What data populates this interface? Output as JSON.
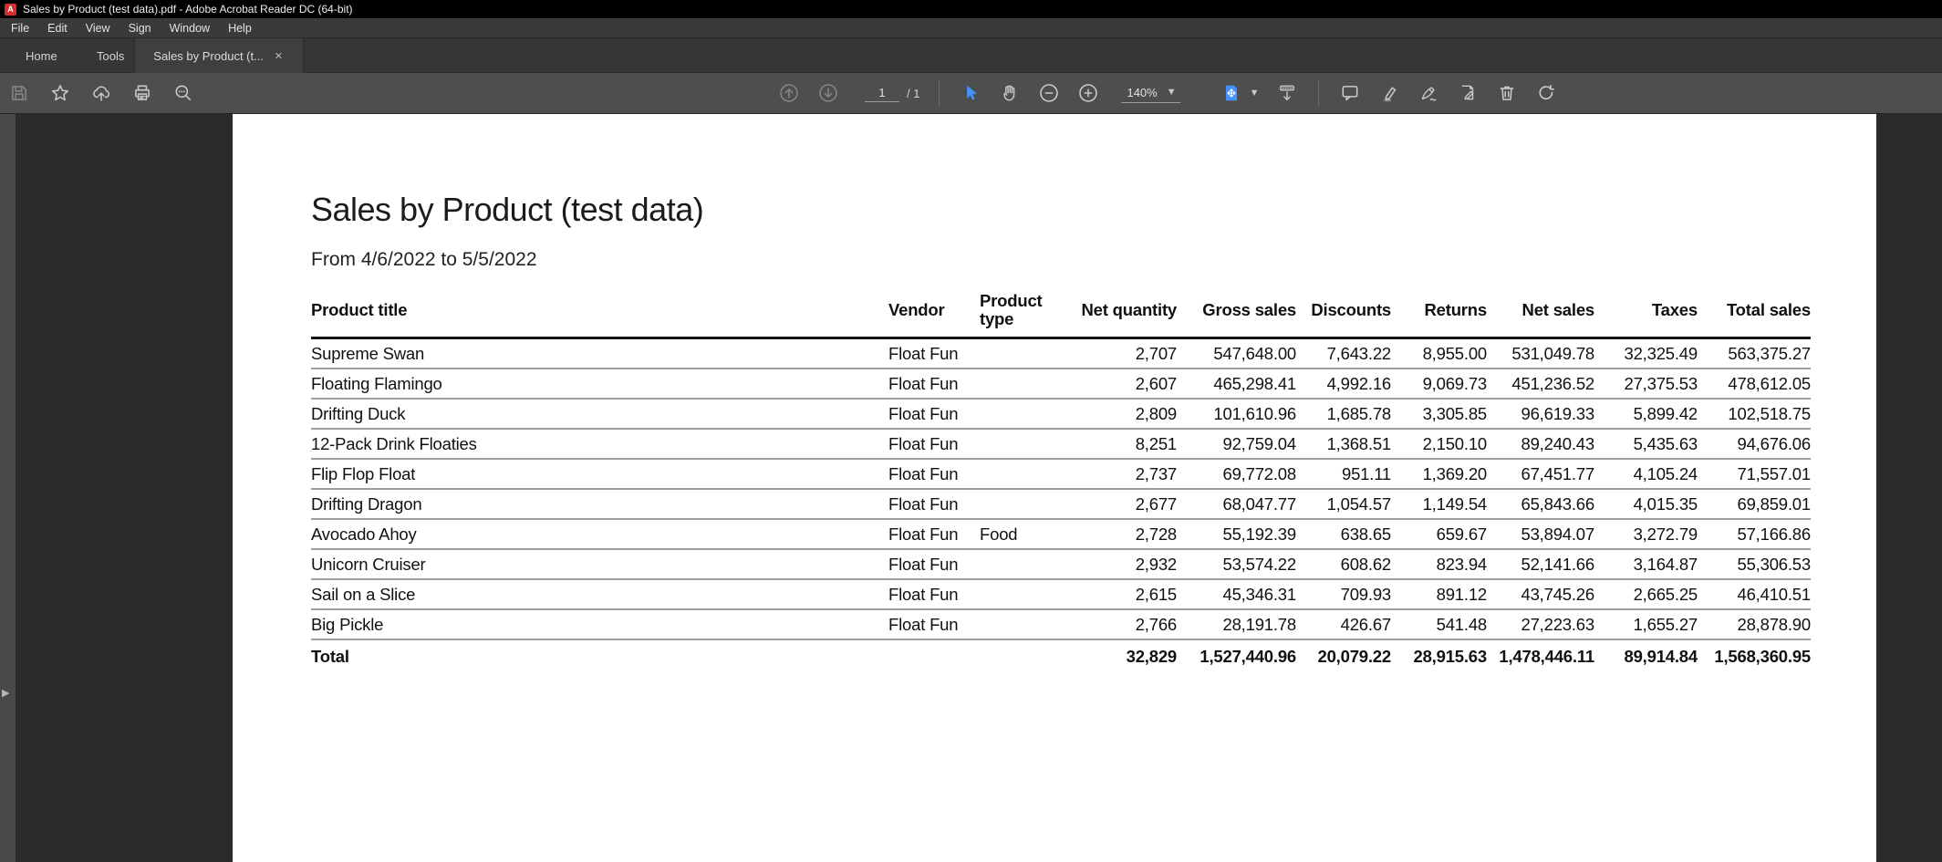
{
  "window": {
    "title": "Sales by Product (test data).pdf - Adobe Acrobat Reader DC (64-bit)",
    "app_icon": "adobe-acrobat-icon"
  },
  "menu": {
    "items": [
      "File",
      "Edit",
      "View",
      "Sign",
      "Window",
      "Help"
    ]
  },
  "tabs": {
    "home": "Home",
    "tools": "Tools",
    "document_tab": "Sales by Product (t...",
    "close": "×"
  },
  "toolbar": {
    "page_current": "1",
    "page_total": "/ 1",
    "zoom_level": "140%",
    "left_icons": [
      "save-icon",
      "star-favorites-icon",
      "cloud-upload-icon",
      "print-icon",
      "search-icon"
    ],
    "center_icons": [
      "page-up-icon",
      "page-down-icon",
      "select-tool-icon",
      "hand-tool-icon",
      "zoom-out-icon",
      "zoom-in-icon",
      "page-display-icon",
      "hide-toolbar-icon",
      "comment-icon",
      "highlight-icon",
      "fill-sign-icon",
      "edit-page-icon",
      "delete-icon",
      "refresh-icon"
    ],
    "accent_color": "#4593ff",
    "icon_color": "#c9c9c9"
  },
  "sidebar": {
    "expand_arrow": "▶"
  },
  "document": {
    "title": "Sales by Product (test data)",
    "subtitle": "From 4/6/2022 to 5/5/2022",
    "table": {
      "columns": [
        "Product title",
        "Vendor",
        "Product type",
        "Net quantity",
        "Gross sales",
        "Discounts",
        "Returns",
        "Net sales",
        "Taxes",
        "Total sales"
      ],
      "rows": [
        [
          "Supreme Swan",
          "Float Fun",
          "",
          "2,707",
          "547,648.00",
          "7,643.22",
          "8,955.00",
          "531,049.78",
          "32,325.49",
          "563,375.27"
        ],
        [
          "Floating Flamingo",
          "Float Fun",
          "",
          "2,607",
          "465,298.41",
          "4,992.16",
          "9,069.73",
          "451,236.52",
          "27,375.53",
          "478,612.05"
        ],
        [
          "Drifting Duck",
          "Float Fun",
          "",
          "2,809",
          "101,610.96",
          "1,685.78",
          "3,305.85",
          "96,619.33",
          "5,899.42",
          "102,518.75"
        ],
        [
          "12-Pack Drink Floaties",
          "Float Fun",
          "",
          "8,251",
          "92,759.04",
          "1,368.51",
          "2,150.10",
          "89,240.43",
          "5,435.63",
          "94,676.06"
        ],
        [
          "Flip Flop Float",
          "Float Fun",
          "",
          "2,737",
          "69,772.08",
          "951.11",
          "1,369.20",
          "67,451.77",
          "4,105.24",
          "71,557.01"
        ],
        [
          "Drifting Dragon",
          "Float Fun",
          "",
          "2,677",
          "68,047.77",
          "1,054.57",
          "1,149.54",
          "65,843.66",
          "4,015.35",
          "69,859.01"
        ],
        [
          "Avocado Ahoy",
          "Float Fun",
          "Food",
          "2,728",
          "55,192.39",
          "638.65",
          "659.67",
          "53,894.07",
          "3,272.79",
          "57,166.86"
        ],
        [
          "Unicorn Cruiser",
          "Float Fun",
          "",
          "2,932",
          "53,574.22",
          "608.62",
          "823.94",
          "52,141.66",
          "3,164.87",
          "55,306.53"
        ],
        [
          "Sail on a Slice",
          "Float Fun",
          "",
          "2,615",
          "45,346.31",
          "709.93",
          "891.12",
          "43,745.26",
          "2,665.25",
          "46,410.51"
        ],
        [
          "Big Pickle",
          "Float Fun",
          "",
          "2,766",
          "28,191.78",
          "426.67",
          "541.48",
          "27,223.63",
          "1,655.27",
          "28,878.90"
        ]
      ],
      "total_row": [
        "Total",
        "",
        "",
        "32,829",
        "1,527,440.96",
        "20,079.22",
        "28,915.63",
        "1,478,446.11",
        "89,914.84",
        "1,568,360.95"
      ]
    }
  },
  "colors": {
    "titlebar": "#000000",
    "menubar": "#3a3a3a",
    "tabbar": "#363636",
    "active_tab": "#3f3f3f",
    "toolbar": "#4e4e4e",
    "workspace": "#2b2b2b",
    "nav_strip": "#494949",
    "page": "#ffffff",
    "header_rule": "#141414",
    "row_rule": "#9e9e9e",
    "accent": "#4593ff",
    "app_icon_red": "#d32f2f"
  }
}
